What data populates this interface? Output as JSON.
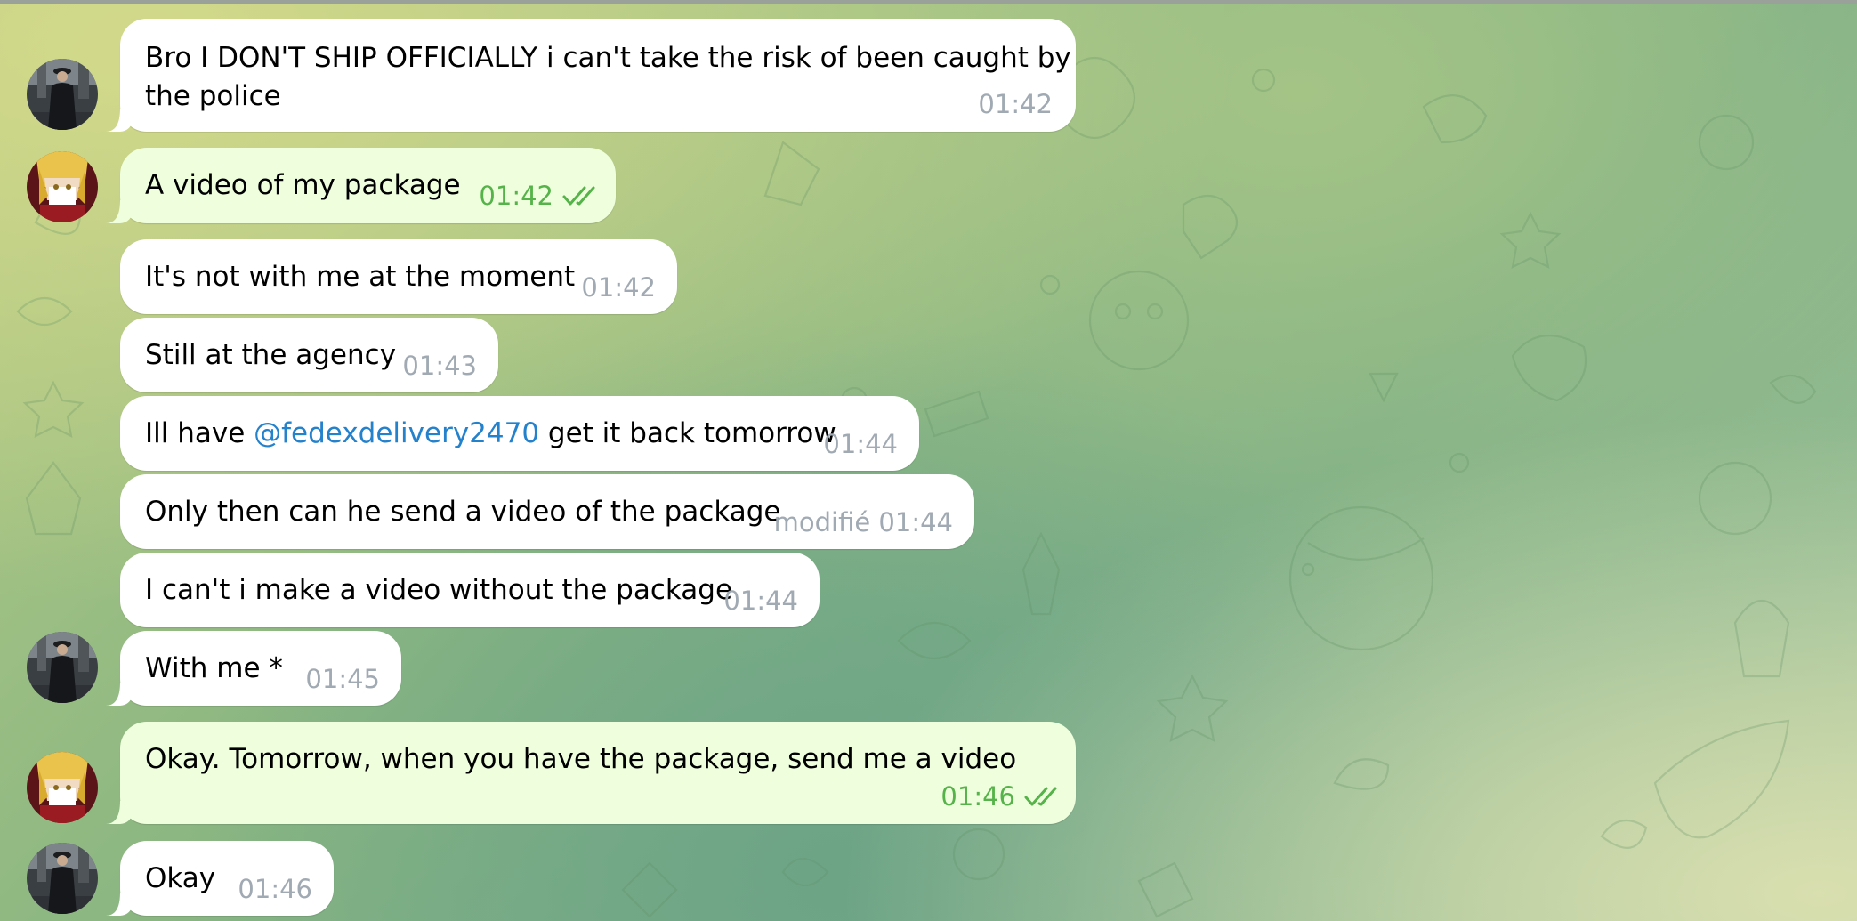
{
  "messages": [
    {
      "direction": "incoming",
      "avatar": "dark-coat-man-avatar",
      "lines": [
        "Bro I DON'T SHIP OFFICIALLY  i can't take the risk of been caught by",
        "the police"
      ],
      "time": "01:42"
    },
    {
      "direction": "outgoing",
      "avatar": "anime-blond-avatar",
      "text": "A video of my package",
      "time": "01:42",
      "read_status": "double-check-icon"
    },
    {
      "direction": "incoming",
      "text": "It's not with me at the moment",
      "time": "01:42"
    },
    {
      "direction": "incoming",
      "text": "Still at the agency",
      "time": "01:43"
    },
    {
      "direction": "incoming",
      "text_before": "Ill have ",
      "mention": "@fedexdelivery2470",
      "text_after": " get it back tomorrow",
      "time": "01:44"
    },
    {
      "direction": "incoming",
      "text": "Only then can he send a video of the package",
      "time": "modifié 01:44"
    },
    {
      "direction": "incoming",
      "text": "I can't i make a video without the package",
      "time": "01:44"
    },
    {
      "direction": "incoming",
      "avatar": "dark-coat-man-avatar",
      "text": "With me *",
      "time": "01:45"
    },
    {
      "direction": "outgoing",
      "avatar": "anime-blond-avatar",
      "text": "Okay. Tomorrow, when you have the package, send me a video",
      "time": "01:46",
      "read_status": "double-check-icon"
    },
    {
      "direction": "incoming",
      "avatar": "dark-coat-man-avatar",
      "text": "Okay",
      "time": "01:46"
    }
  ],
  "colors": {
    "incoming_bubble": "#ffffff",
    "outgoing_bubble": "#effedd",
    "mention": "#2481cc",
    "outgoing_meta": "#56b34a",
    "incoming_meta": "#a1aab3"
  }
}
